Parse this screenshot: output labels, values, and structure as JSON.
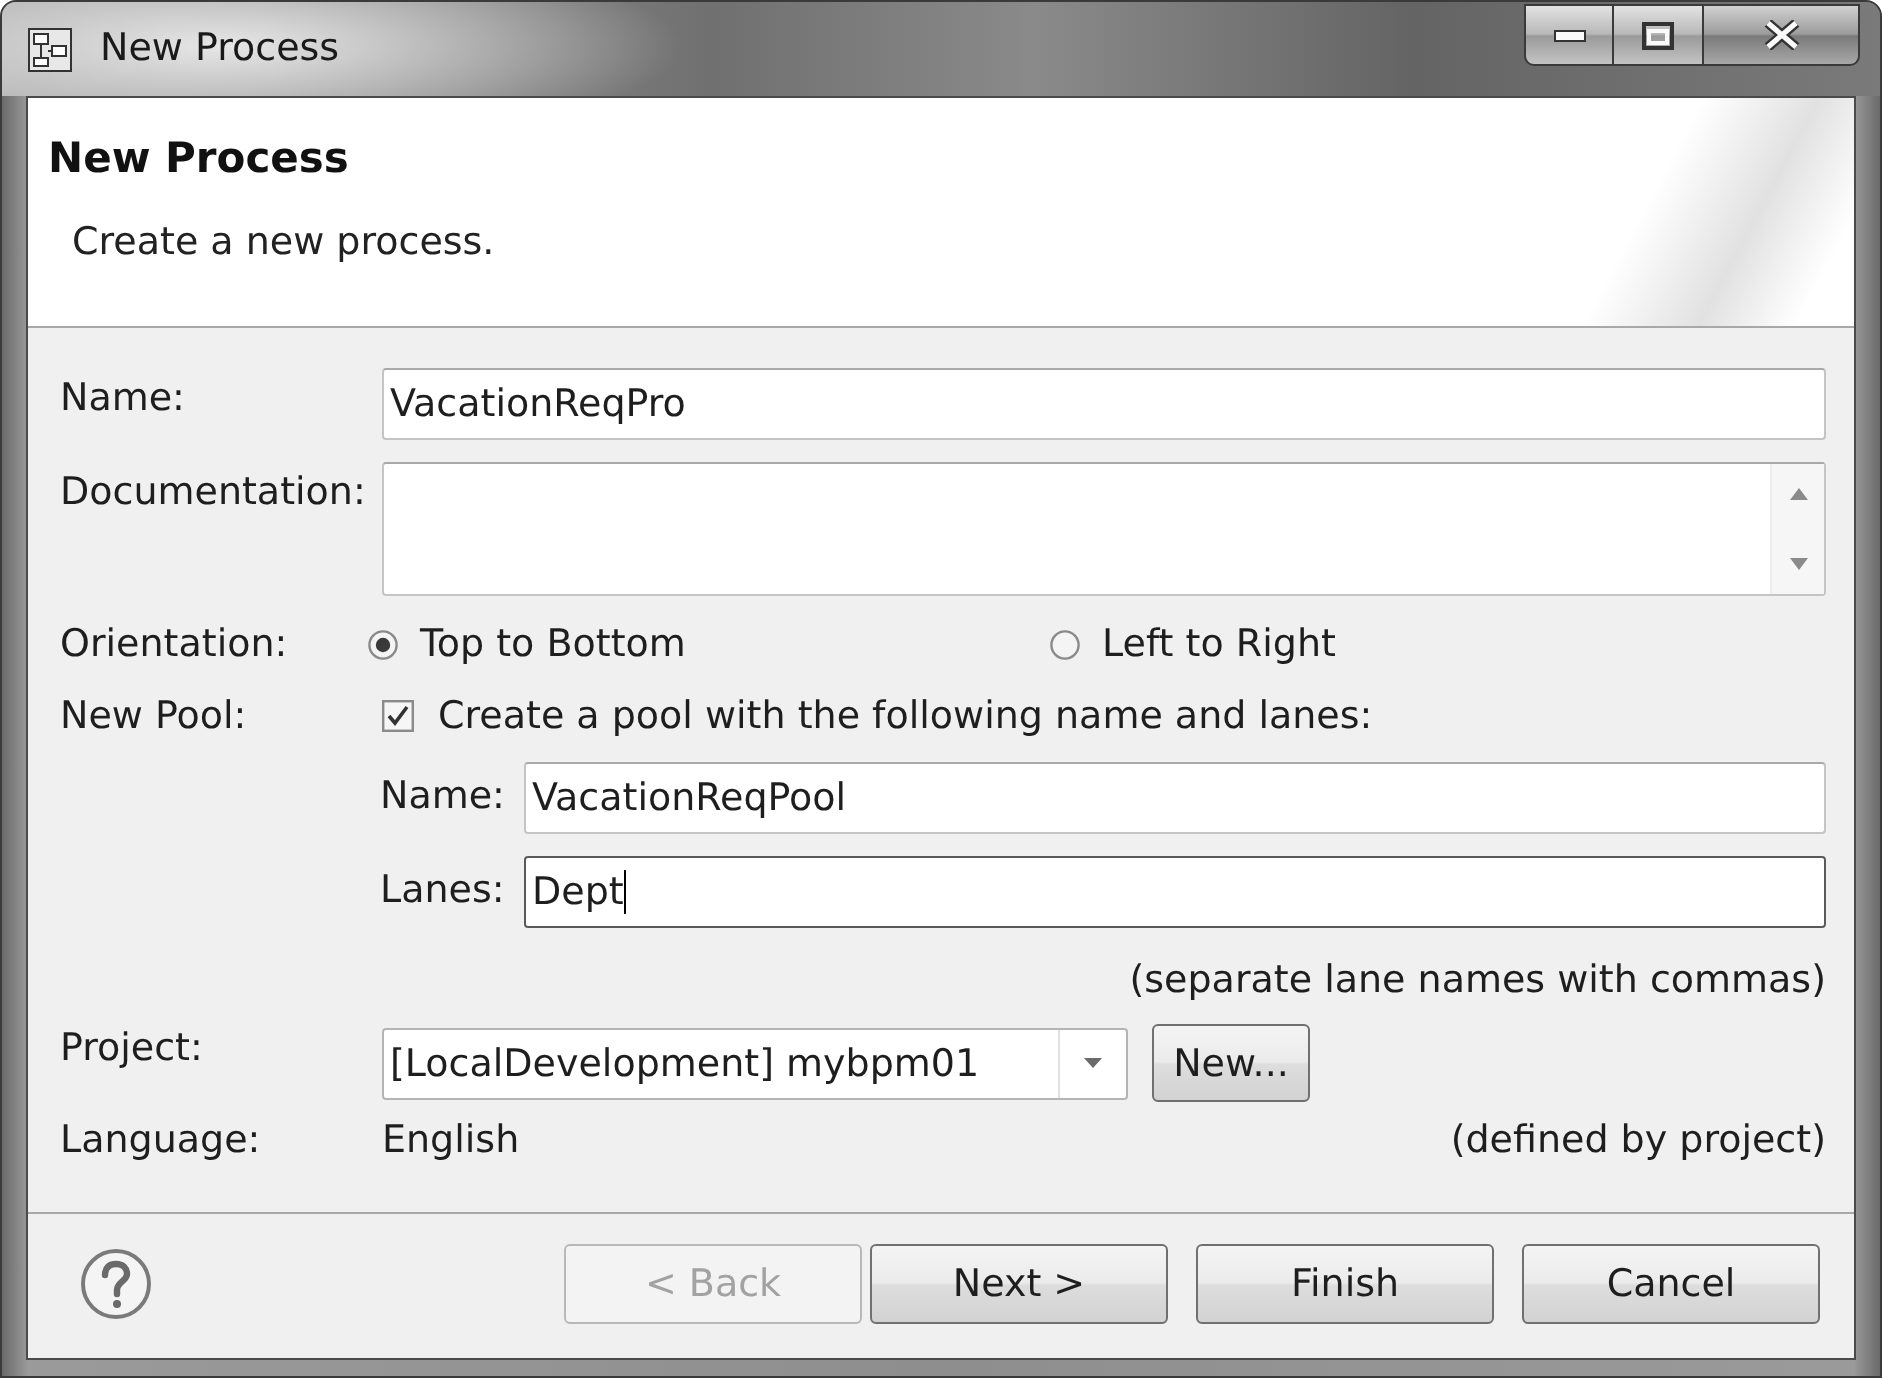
{
  "window": {
    "title": "New Process"
  },
  "header": {
    "title": "New Process",
    "description": "Create a new process."
  },
  "form": {
    "name": {
      "label": "Name:",
      "value": "VacationReqPro"
    },
    "documentation": {
      "label": "Documentation:"
    },
    "orientation": {
      "label": "Orientation:",
      "options": [
        {
          "label": "Top to Bottom",
          "selected": true
        },
        {
          "label": "Left to Right",
          "selected": false
        }
      ]
    },
    "new_pool": {
      "label": "New Pool:",
      "checkbox": {
        "label": "Create a pool with the following name and lanes:",
        "checked": true
      },
      "name": {
        "label": "Name:",
        "value": "VacationReqPool",
        "focused": false
      },
      "lanes": {
        "label": "Lanes:",
        "value": "Dept",
        "focused": true
      },
      "hint": "(separate lane names with commas)"
    },
    "project": {
      "label": "Project:",
      "value": "[LocalDevelopment] mybpm01",
      "button": {
        "label": "New..."
      }
    },
    "language": {
      "label": "Language:",
      "value": "English",
      "note": "(defined by project)"
    }
  },
  "buttons": [
    {
      "label": "< Back",
      "disabled": true
    },
    {
      "label": "Next >",
      "disabled": false
    },
    {
      "label": "Finish",
      "disabled": false
    },
    {
      "label": "Cancel",
      "disabled": false
    }
  ]
}
